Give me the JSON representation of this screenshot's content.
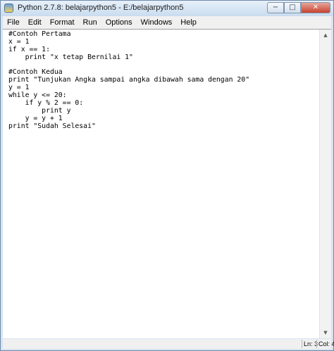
{
  "window": {
    "title": "Python 2.7.8: belajarpython5 - E:/belajarpython5",
    "minimize_glyph": "−",
    "maximize_glyph": "□",
    "close_glyph": "✕"
  },
  "menu": [
    "File",
    "Edit",
    "Format",
    "Run",
    "Options",
    "Windows",
    "Help"
  ],
  "editor": {
    "lines": [
      "#Contoh Pertama",
      "x = 1",
      "if x == 1:",
      "    print \"x tetap Bernilai 1\"",
      "",
      "#Contoh Kedua",
      "print \"Tunjukan Angka sampai angka dibawah sama dengan 20\"",
      "y = 1",
      "while y <= 20:",
      "    if y % 2 == 0:",
      "        print y",
      "    y = y + 1",
      "print \"Sudah Selesai\""
    ]
  },
  "scrollbar": {
    "up_glyph": "▲",
    "down_glyph": "▼"
  },
  "status": {
    "line": "Ln: 3",
    "col": "Col: 4"
  },
  "colors": {
    "window_frame": "#d6e4f2",
    "close_button": "#c8422f",
    "editor_bg": "#ffffff",
    "text": "#000000"
  }
}
